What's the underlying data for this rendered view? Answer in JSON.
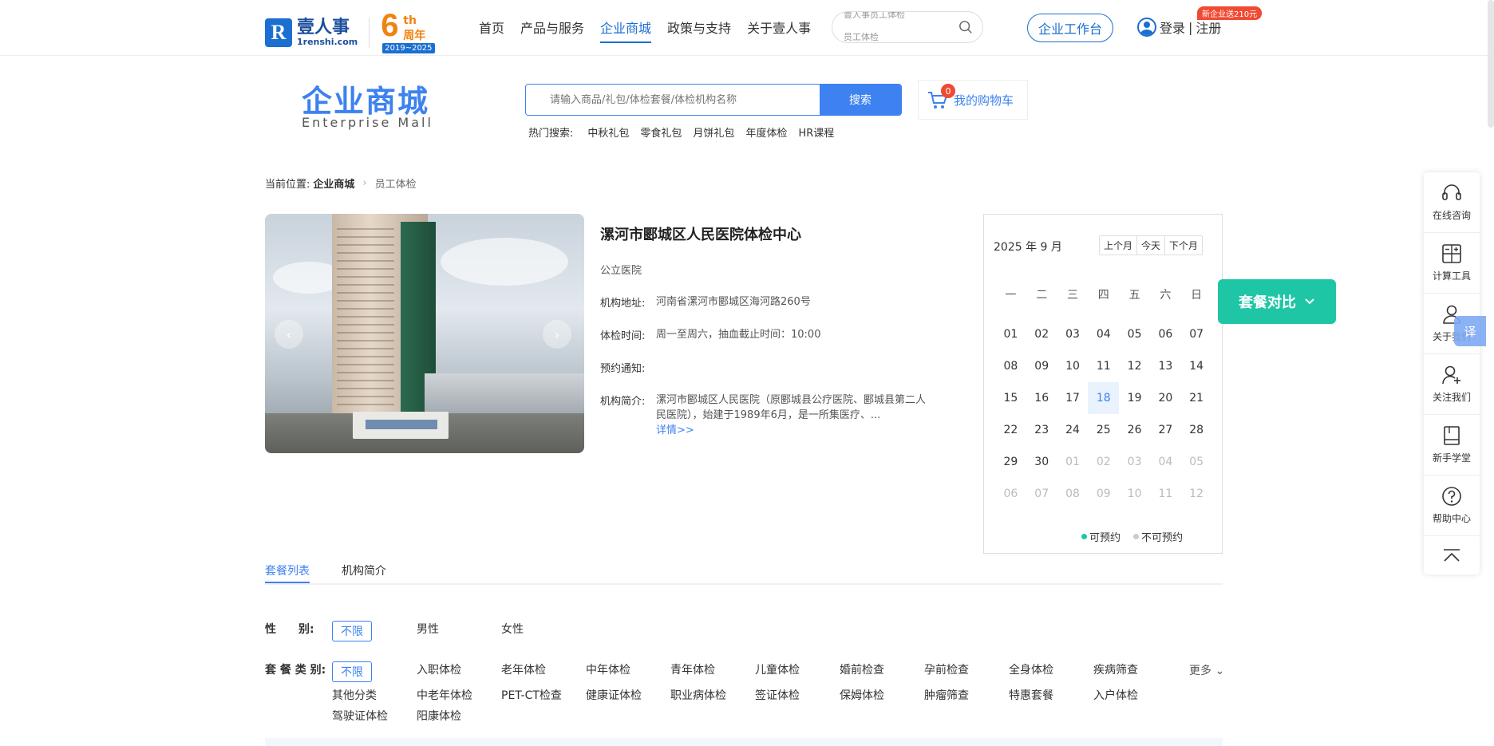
{
  "header": {
    "logo_name": "壹人事",
    "logo_domain": "1renshi.com",
    "anniv_num": "6",
    "anniv_th": "th",
    "anniv_zh": "周年",
    "anniv_years": "2019~2025",
    "nav": [
      "首页",
      "产品与服务",
      "企业商城",
      "政策与支持",
      "关于壹人事"
    ],
    "search_ticker": [
      "壹人事员工体检",
      "员工体检"
    ],
    "workbench_label": "企业工作台",
    "login_label": "登录",
    "register_label": "注册",
    "login_sep": "|",
    "promo_badge": "新企业送210元"
  },
  "mall": {
    "title": "企业商城",
    "subtitle": "Enterprise  Mall",
    "search_placeholder": "请输入商品/礼包/体检套餐/体检机构名称",
    "search_button": "搜索",
    "hot_label": "热门搜索:",
    "hot_terms": [
      "中秋礼包",
      "零食礼包",
      "月饼礼包",
      "年度体检",
      "HR课程"
    ],
    "cart_label": "我的购物车",
    "cart_count": "0"
  },
  "breadcrumb": {
    "label": "当前位置:",
    "parent": "企业商城",
    "current": "员工体检"
  },
  "institution": {
    "name": "漯河市郾城区人民医院体检中心",
    "type": "公立医院",
    "address_label": "机构地址:",
    "address": "河南省漯河市郾城区海河路260号",
    "hours_label": "体检时间:",
    "hours": "周一至周六，抽血截止时间：10:00",
    "notice_label": "预约通知:",
    "notice": "",
    "intro_label": "机构简介:",
    "intro": "漯河市郾城区人民医院（原郾城县公疗医院、郾城县第二人民医院），始建于1989年6月，是一所集医疗、...",
    "more_link": "详情>>"
  },
  "calendar": {
    "title": "2025 年 9 月",
    "prev_btn": "上个月",
    "today_btn": "今天",
    "next_btn": "下个月",
    "weekdays": [
      "一",
      "二",
      "三",
      "四",
      "五",
      "六",
      "日"
    ],
    "days": [
      {
        "d": "01"
      },
      {
        "d": "02"
      },
      {
        "d": "03"
      },
      {
        "d": "04"
      },
      {
        "d": "05"
      },
      {
        "d": "06"
      },
      {
        "d": "07"
      },
      {
        "d": "08"
      },
      {
        "d": "09"
      },
      {
        "d": "10"
      },
      {
        "d": "11"
      },
      {
        "d": "12"
      },
      {
        "d": "13"
      },
      {
        "d": "14"
      },
      {
        "d": "15"
      },
      {
        "d": "16"
      },
      {
        "d": "17"
      },
      {
        "d": "18",
        "today": true
      },
      {
        "d": "19"
      },
      {
        "d": "20"
      },
      {
        "d": "21"
      },
      {
        "d": "22"
      },
      {
        "d": "23"
      },
      {
        "d": "24"
      },
      {
        "d": "25"
      },
      {
        "d": "26"
      },
      {
        "d": "27"
      },
      {
        "d": "28"
      },
      {
        "d": "29"
      },
      {
        "d": "30"
      },
      {
        "d": "01",
        "dim": true
      },
      {
        "d": "02",
        "dim": true
      },
      {
        "d": "03",
        "dim": true
      },
      {
        "d": "04",
        "dim": true
      },
      {
        "d": "05",
        "dim": true
      },
      {
        "d": "06",
        "dim": true
      },
      {
        "d": "07",
        "dim": true
      },
      {
        "d": "08",
        "dim": true
      },
      {
        "d": "09",
        "dim": true
      },
      {
        "d": "10",
        "dim": true
      },
      {
        "d": "11",
        "dim": true
      },
      {
        "d": "12",
        "dim": true
      }
    ],
    "legend_available": "可预约",
    "legend_unavailable": "不可预约",
    "available_color": "#1fc6a6",
    "unavailable_color": "#cccccc"
  },
  "compare_label": "套餐对比",
  "tabs": [
    "套餐列表",
    "机构简介"
  ],
  "filters": {
    "gender_label": "性　　别:",
    "gender_options": [
      "不限",
      "男性",
      "女性"
    ],
    "category_label": "套 餐 类 别:",
    "category_options": [
      "不限",
      "入职体检",
      "老年体检",
      "中年体检",
      "青年体检",
      "儿童体检",
      "婚前检查",
      "孕前检查",
      "全身体检",
      "疾病筛查",
      "其他分类",
      "中老年体检",
      "PET-CT检查",
      "健康证体检",
      "职业病体检",
      "签证体检",
      "保姆体检",
      "肿瘤筛查",
      "特惠套餐",
      "入户体检",
      "驾驶证体检",
      "阳康体检"
    ],
    "more_label": "更多"
  },
  "sidebar": {
    "items": [
      "在线咨询",
      "计算工具",
      "关于我们",
      "关注我们",
      "新手学堂",
      "帮助中心"
    ],
    "translate": "译"
  },
  "colors": {
    "brand": "#1b6fd0",
    "accent": "#3d82f0",
    "compare": "#1fc6a6",
    "badge": "#f04a33",
    "anniversary": "#f2820f"
  }
}
